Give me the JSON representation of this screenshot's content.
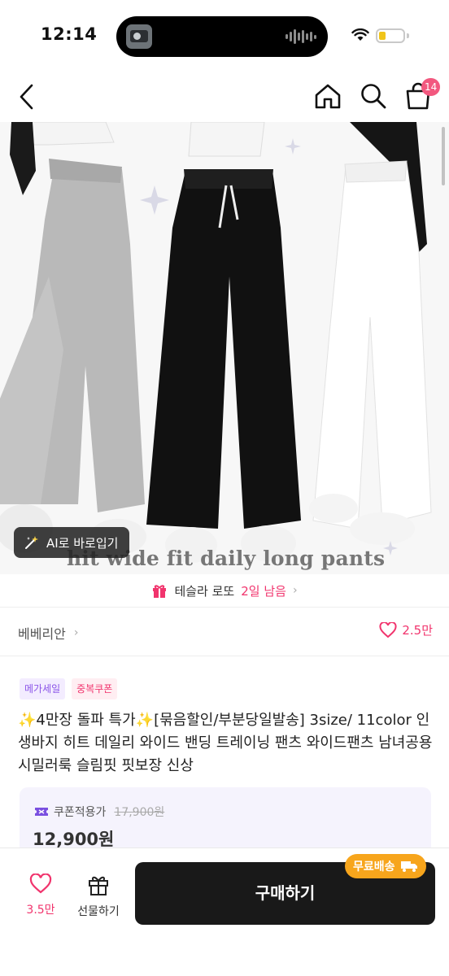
{
  "status_bar": {
    "time": "12:14"
  },
  "header": {
    "cart_count": "14"
  },
  "hero": {
    "ai_button_label": "AI로 바로입기",
    "caption": "hit wide fit daily long pants"
  },
  "lotto": {
    "prefix": "테슬라 로또",
    "highlight": "2일 남음"
  },
  "shop": {
    "name": "베베리안",
    "likes": "2.5만"
  },
  "tags": [
    "메가세일",
    "중복쿠폰"
  ],
  "product_title": "✨4만장 돌파 특가✨[묶음할인/부분당일발송] 3size/ 11color 인생바지 히트 데일리 와이드 밴딩 트레이닝 팬츠 와이드팬츠 남녀공용 시밀러룩 슬림핏 핏보장 신상",
  "price": {
    "coupon_label": "쿠폰적용가",
    "original": "17,900원",
    "final": "12,900원"
  },
  "bottom_bar": {
    "like_count": "3.5만",
    "gift_label": "선물하기",
    "buy_label": "구매하기",
    "free_shipping_label": "무료배송"
  },
  "colors": {
    "accent_pink": "#f1346d",
    "badge_pink": "#f2587f",
    "purple": "#8a53e8",
    "free_ship_orange": "#f7a51c",
    "buy_button": "#191919"
  }
}
